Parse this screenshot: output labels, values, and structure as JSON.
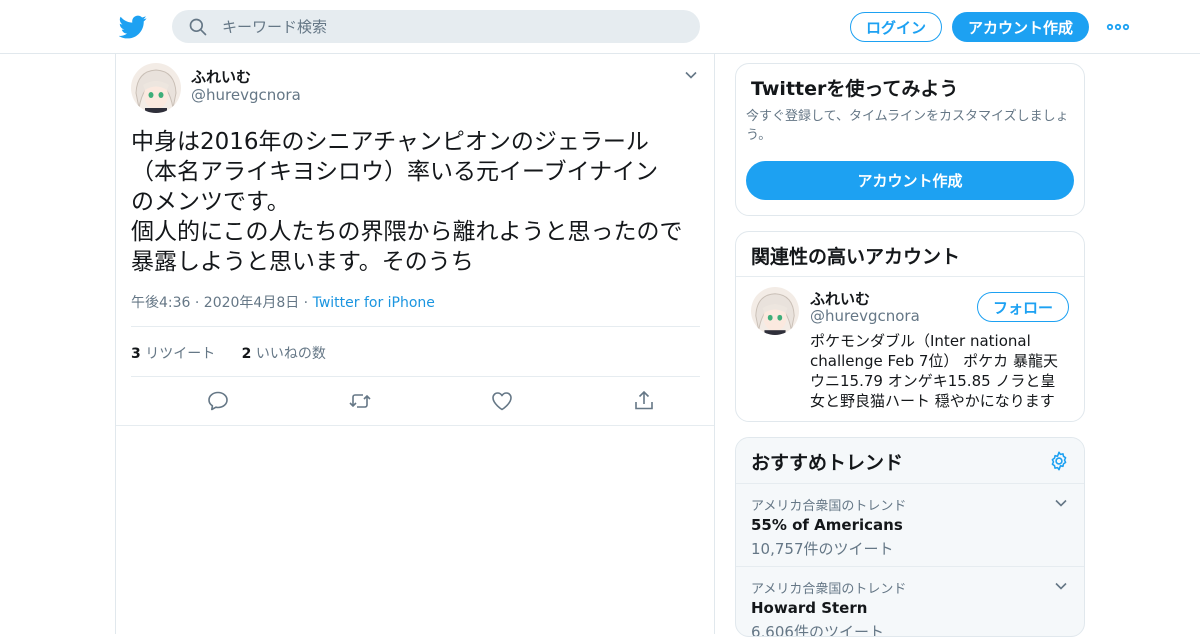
{
  "header": {
    "logo": "twitter-bird-icon",
    "search_placeholder": "キーワード検索",
    "login_label": "ログイン",
    "signup_label": "アカウント作成",
    "more_icon": "ellipsis-icon",
    "accent": "#1da1f2"
  },
  "tweet": {
    "name": "ふれいむ",
    "handle": "@hurevgcnora",
    "text": "中身は2016年のシニアチャンピオンのジェラール\n（本名アライキヨシロウ）率いる元イーブイナイン\nのメンツです。\n個人的にこの人たちの界隈から離れようと思ったので\n暴露しようと思います。そのうち",
    "time": "午後4:36 · 2020年4月8日 · ",
    "source": "Twitter for iPhone",
    "retweets_count": "3",
    "retweets_label": "リツイート",
    "likes_count": "2",
    "likes_label": "いいねの数"
  },
  "signup_card": {
    "title": "Twitterを使ってみよう",
    "subtitle": "今すぐ登録して、タイムラインをカスタマイズしましょう。",
    "button": "アカウント作成"
  },
  "related": {
    "title": "関連性の高いアカウント",
    "name": "ふれいむ",
    "handle": "@hurevgcnora",
    "follow": "フォロー",
    "bio": "ポケモンダブル（Inter national challenge Feb 7位） ポケカ 暴龍天 ウニ15.79 オンゲキ15.85 ノラと皇女と野良猫ハート 穏やかになります"
  },
  "trends": {
    "title": "おすすめトレンド",
    "items": [
      {
        "context": "アメリカ合衆国のトレンド",
        "name": "55% of Americans",
        "count": "10,757件のツイート"
      },
      {
        "context": "アメリカ合衆国のトレンド",
        "name": "Howard Stern",
        "count": "6,606件のツイート"
      }
    ]
  }
}
